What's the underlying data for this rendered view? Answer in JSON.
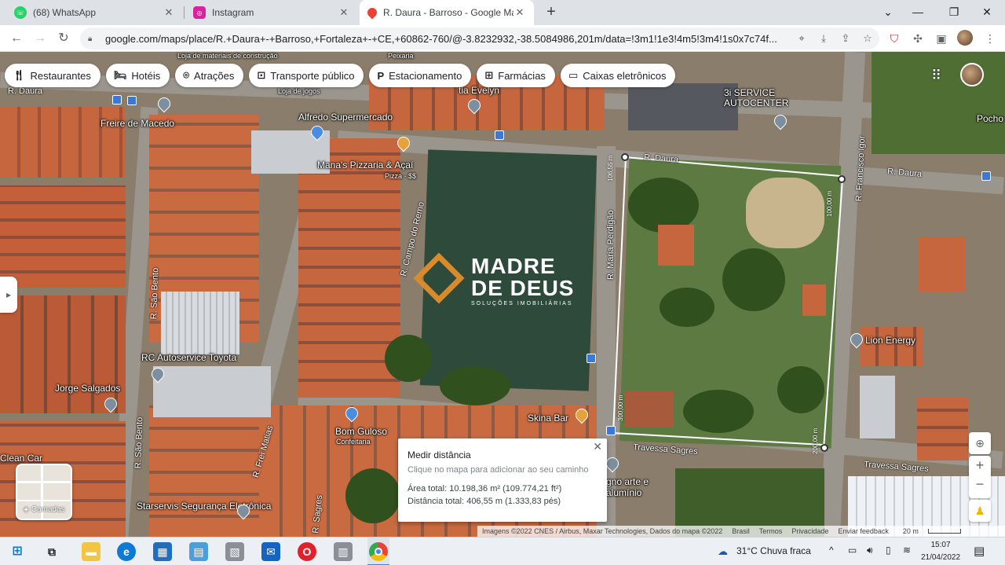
{
  "tabs": [
    {
      "title": "(68) WhatsApp",
      "icon": "whatsapp-icon",
      "color": "#25d366"
    },
    {
      "title": "Instagram",
      "icon": "instagram-icon",
      "color": "#d6249f"
    },
    {
      "title": "R. Daura - Barroso - Google Map",
      "icon": "google-maps-icon",
      "color": "#ea4335"
    }
  ],
  "toolbar": {
    "url": "google.com/maps/place/R.+Daura+-+Barroso,+Fortaleza+-+CE,+60862-760/@-3.8232932,-38.5084986,201m/data=!3m1!1e3!4m5!3m4!1s0x7c74f..."
  },
  "chips": [
    {
      "label": "Restaurantes",
      "icon": "fork-knife-icon"
    },
    {
      "label": "Hotéis",
      "icon": "bed-icon"
    },
    {
      "label": "Atrações",
      "icon": "camera-icon"
    },
    {
      "label": "Transporte público",
      "icon": "bus-icon"
    },
    {
      "label": "Estacionamento",
      "icon": "parking-icon"
    },
    {
      "label": "Farmácias",
      "icon": "pharmacy-icon"
    },
    {
      "label": "Caixas eletrônicos",
      "icon": "atm-icon"
    }
  ],
  "map": {
    "places": [
      "R. Daura",
      "Freire de Macedo",
      "Alfredo Supermercado",
      "Mana's Pizzaria & Açaí",
      "Pizza · $$",
      "tia Evelyn",
      "Loja de jogos",
      "Loja de materiais de construção",
      "Peixaria",
      "3i SERVICE AUTOCENTER",
      "Pocho",
      "R. Daura",
      "R. Daura",
      "R. Francisco Igor",
      "R. Campo do Remo",
      "R. Maria Perdigão",
      "R. São Bento",
      "Lion Energy",
      "RC Autoservice Toyota",
      "Jorge Salgados",
      "Skina Bar",
      "Bom Guloso",
      "Confeitaria",
      "R. São Bento",
      "R. Frei Matias",
      "Clean Car",
      "Starservis Segurança Eletrônica",
      "R. Sagres",
      "Travessa Sagres",
      "Travessa Sagres",
      "gno arte e alumínio"
    ],
    "measure_labels": [
      "106,55 m",
      "100,00 m",
      "300,00 m",
      "200,00 m"
    ]
  },
  "watermark": {
    "name_line1": "MADRE",
    "name_line2": "DE DEUS",
    "tagline": "SOLUÇÕES IMOBILIÁRIAS"
  },
  "layers_label": "Camadas",
  "measure": {
    "title": "Medir distância",
    "hint": "Clique no mapa para adicionar ao seu caminho",
    "area": "Área total: 10.198,36 m² (109.774,21 ft²)",
    "distance": "Distância total: 406,55 m (1.333,83 pés)"
  },
  "attribution": [
    "Imagens ©2022 CNES / Airbus, Maxar Technologies, Dados do mapa ©2022",
    "Brasil",
    "Termos",
    "Privacidade",
    "Enviar feedback",
    "20 m"
  ],
  "taskbar": {
    "weather": "31°C  Chuva fraca",
    "time": "15:07",
    "date": "21/04/2022"
  }
}
